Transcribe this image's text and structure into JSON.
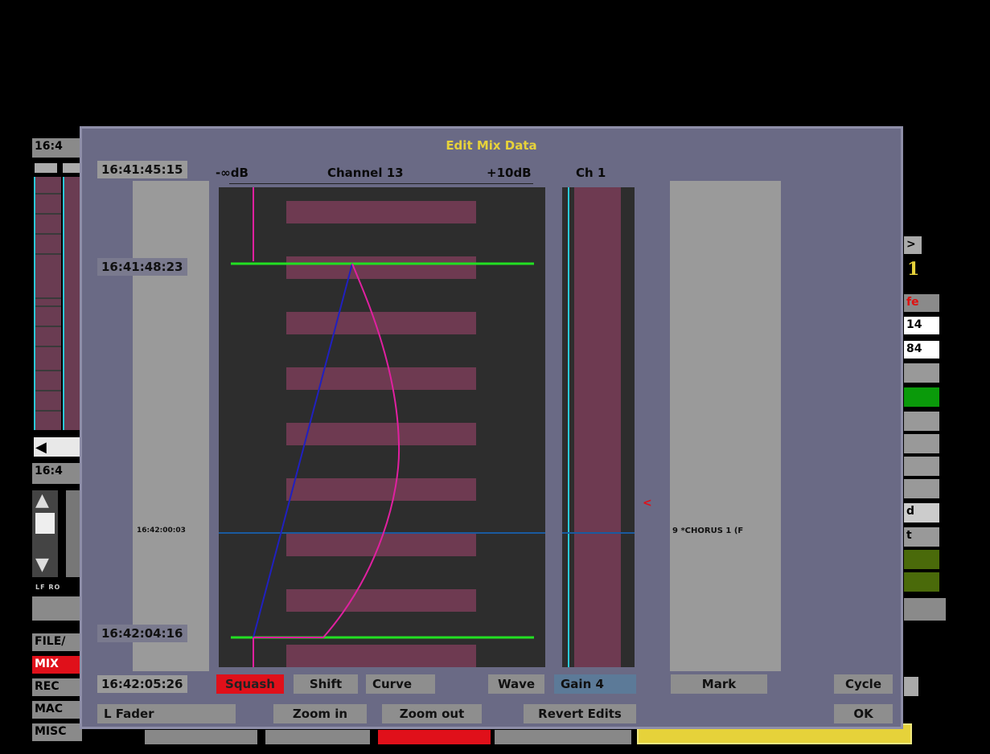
{
  "background": {
    "time_top": "16:4",
    "time_mid": "16:4",
    "right_labels": [
      ">",
      "1",
      "fe",
      "14",
      "84",
      "d",
      "t"
    ],
    "bottom_left_label": "LF RO",
    "menu": [
      {
        "label": "FILE/",
        "active": false
      },
      {
        "label": "MIX",
        "active": true
      },
      {
        "label": "REC",
        "active": false
      },
      {
        "label": "MAC",
        "active": false
      },
      {
        "label": "MISC",
        "active": false
      }
    ]
  },
  "dialog": {
    "title": "Edit Mix Data",
    "timecode_top": "16:41:45:15",
    "timecode_marker_top": "16:41:48:23",
    "timecode_cursor": "16:42:00:03",
    "timecode_marker_bottom": "16:42:04:16",
    "timecode_bottom": "16:42:05:26",
    "scale_min": "-∞dB",
    "channel_label": "Channel 13",
    "scale_max": "+10dB",
    "ch_label": "Ch 1",
    "track_label": "9 *CHORUS 1 (F",
    "buttons": {
      "squash": "Squash",
      "shift": "Shift",
      "curve": "Curve",
      "wave": "Wave",
      "gain": "Gain 4",
      "mark": "Mark",
      "cycle": "Cycle",
      "l_fader": "L Fader",
      "zoom_in": "Zoom in",
      "zoom_out": "Zoom out",
      "revert_edits": "Revert Edits",
      "ok": "OK"
    }
  },
  "colors": {
    "dialog_bg": "#6a6a85",
    "title": "#e6d23a",
    "marker_line": "#22e022",
    "cursor_line": "#1a5aa0",
    "curve_original": "#2020c0",
    "curve_new": "#e020a0",
    "active_button": "#e0101a",
    "selected_button": "#5c7a98"
  }
}
